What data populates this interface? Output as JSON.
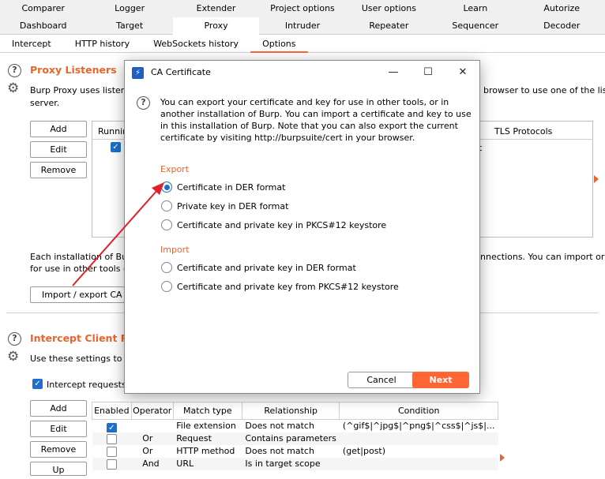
{
  "tabs_row1": [
    "Comparer",
    "Logger",
    "Extender",
    "Project options",
    "User options",
    "Learn",
    "Autorize"
  ],
  "tabs_row2": [
    "Dashboard",
    "Target",
    "Proxy",
    "Intruder",
    "Repeater",
    "Sequencer",
    "Decoder"
  ],
  "tabs_row2_active": "Proxy",
  "proxy_subtabs": [
    "Intercept",
    "HTTP history",
    "WebSockets history",
    "Options"
  ],
  "proxy_subtabs_active": "Options",
  "listeners": {
    "title": "Proxy Listeners",
    "desc_line1": "Burp Proxy uses listener",
    "desc_right": "browser to use one of the lis",
    "desc_line2": "server.",
    "buttons": {
      "add": "Add",
      "edit": "Edit",
      "remove": "Remove"
    },
    "col_running": "Runnin",
    "col_tls": "TLS Protocols",
    "col_tls_value": "t",
    "ca_text_line1": "Each installation of Bur",
    "ca_text_right": "nnections. You can import or e",
    "ca_text_line2": "for use in other tools o",
    "import_export_btn": "Import / export CA ce"
  },
  "intercept": {
    "title": "Intercept Client Req",
    "desc": "Use these settings to co",
    "checkbox_label": "Intercept requests b",
    "buttons": {
      "add": "Add",
      "edit": "Edit",
      "remove": "Remove",
      "up": "Up"
    },
    "columns": [
      "Enabled",
      "Operator",
      "Match type",
      "Relationship",
      "Condition"
    ],
    "rows": [
      {
        "enabled": true,
        "operator": "",
        "match": "File extension",
        "rel": "Does not match",
        "cond": "(^gif$|^jpg$|^png$|^css$|^js$|..."
      },
      {
        "enabled": false,
        "operator": "Or",
        "match": "Request",
        "rel": "Contains parameters",
        "cond": ""
      },
      {
        "enabled": false,
        "operator": "Or",
        "match": "HTTP method",
        "rel": "Does not match",
        "cond": "(get|post)"
      },
      {
        "enabled": false,
        "operator": "And",
        "match": "URL",
        "rel": "Is in target scope",
        "cond": ""
      }
    ]
  },
  "dialog": {
    "title": "CA Certificate",
    "description": "You can export your certificate and key for use in other tools, or in another installation of Burp. You can import a certificate and key to use in this installation of Burp. Note that you can also export the current certificate by visiting http://burpsuite/cert in your browser.",
    "export_heading": "Export",
    "export_options": [
      "Certificate in DER format",
      "Private key in DER format",
      "Certificate and private key in PKCS#12 keystore"
    ],
    "selected_option": "Certificate in DER format",
    "import_heading": "Import",
    "import_options": [
      "Certificate and private key in DER format",
      "Certificate and private key from PKCS#12 keystore"
    ],
    "cancel_label": "Cancel",
    "next_label": "Next"
  },
  "colors": {
    "accent": "#ff6633",
    "heading": "#e8652b",
    "selection": "#1e6fc8",
    "arrow": "#e0202a"
  }
}
